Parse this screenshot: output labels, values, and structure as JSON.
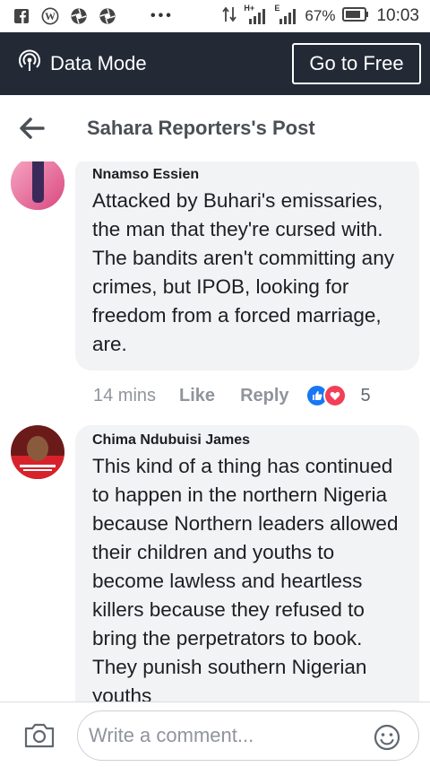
{
  "status_bar": {
    "battery_percent": "67%",
    "time": "10:03",
    "network_label": "H+",
    "network_label_2": "E",
    "notification_icons": [
      "facebook-icon",
      "wordpress-icon",
      "aperture-icon",
      "aperture-icon"
    ]
  },
  "data_bar": {
    "label": "Data Mode",
    "button_label": "Go to Free"
  },
  "header": {
    "title": "Sahara Reporters's Post"
  },
  "comments": [
    {
      "author": "Nnamso Essien",
      "text": "Attacked by Buhari's emissaries, the man that they're cursed with. The bandits aren't committing any crimes, but IPOB, looking for freedom from a forced marriage, are.",
      "time": "14 mins",
      "like_label": "Like",
      "reply_label": "Reply",
      "reaction_count": "5",
      "reactions": [
        "like-reaction-icon",
        "love-reaction-icon"
      ]
    },
    {
      "author": "Chima Ndubuisi James",
      "text": "This kind of a thing has continued to happen in the northern Nigeria because Northern leaders allowed their children and youths to become lawless and heartless killers because they refused to bring the perpetrators to book. They punish southern Nigerian youths"
    }
  ],
  "composer": {
    "placeholder": "Write a comment..."
  },
  "colors": {
    "data_bar_bg": "#232a36",
    "bubble_bg": "#f2f3f5",
    "like_blue": "#1877f2",
    "love_red": "#f33e58"
  }
}
